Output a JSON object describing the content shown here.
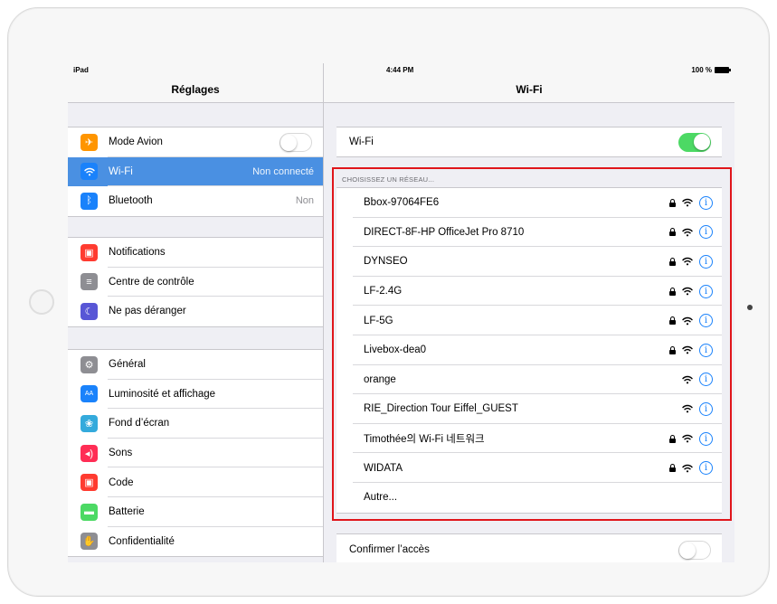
{
  "status_bar": {
    "device": "iPad",
    "time": "4:44 PM",
    "battery": "100 %"
  },
  "sidebar": {
    "title": "Réglages",
    "groups": [
      [
        {
          "label": "Mode Avion",
          "icon": "airplane-icon",
          "color": "#ff9500",
          "glyph": "✈",
          "toggle": "off"
        },
        {
          "label": "Wi-Fi",
          "icon": "wifi-icon",
          "color": "#1a82fb",
          "glyph": "",
          "value": "Non connecté",
          "selected": true
        },
        {
          "label": "Bluetooth",
          "icon": "bluetooth-icon",
          "color": "#1a82fb",
          "glyph": "ᛒ",
          "value": "Non"
        }
      ],
      [
        {
          "label": "Notifications",
          "icon": "notifications-icon",
          "color": "#ff3b30",
          "glyph": "▣"
        },
        {
          "label": "Centre de contrôle",
          "icon": "control-center-icon",
          "color": "#8e8e93",
          "glyph": "≡"
        },
        {
          "label": "Ne pas déranger",
          "icon": "moon-icon",
          "color": "#5856d6",
          "glyph": "☾"
        }
      ],
      [
        {
          "label": "Général",
          "icon": "gear-icon",
          "color": "#8e8e93",
          "glyph": "⚙"
        },
        {
          "label": "Luminosité et affichage",
          "icon": "display-icon",
          "color": "#1a82fb",
          "glyph": "AA"
        },
        {
          "label": "Fond d’écran",
          "icon": "wallpaper-icon",
          "color": "#34aadc",
          "glyph": "❀"
        },
        {
          "label": "Sons",
          "icon": "sound-icon",
          "color": "#ff2d55",
          "glyph": "◂)"
        },
        {
          "label": "Code",
          "icon": "lock-icon",
          "color": "#ff3b30",
          "glyph": "▣"
        },
        {
          "label": "Batterie",
          "icon": "battery-icon",
          "color": "#4cd964",
          "glyph": "▬"
        },
        {
          "label": "Confidentialité",
          "icon": "privacy-hand-icon",
          "color": "#8e8e93",
          "glyph": "✋"
        }
      ]
    ]
  },
  "detail": {
    "title": "Wi-Fi",
    "wifi_label": "Wi-Fi",
    "wifi_toggle": "on",
    "section_header": "CHOISISSEZ UN RÉSEAU...",
    "networks": [
      {
        "name": "Bbox-97064FE6",
        "locked": true
      },
      {
        "name": "DIRECT-8F-HP OfficeJet Pro 8710",
        "locked": true
      },
      {
        "name": "DYNSEO",
        "locked": true
      },
      {
        "name": "LF-2.4G",
        "locked": true
      },
      {
        "name": "LF-5G",
        "locked": true
      },
      {
        "name": "Livebox-dea0",
        "locked": true
      },
      {
        "name": "orange",
        "locked": false
      },
      {
        "name": "RIE_Direction Tour Eiffel_GUEST",
        "locked": false
      },
      {
        "name": "Timothée의 Wi-Fi 네트워크",
        "locked": true
      },
      {
        "name": "WIDATA",
        "locked": true
      }
    ],
    "other_label": "Autre...",
    "confirm_label": "Confirmer l’accès",
    "confirm_toggle": "off"
  },
  "colors": {
    "accent": "#1a82fb",
    "toggle_on": "#4cd964",
    "highlight": "#e0161b",
    "selected_row": "#4a90e2"
  }
}
